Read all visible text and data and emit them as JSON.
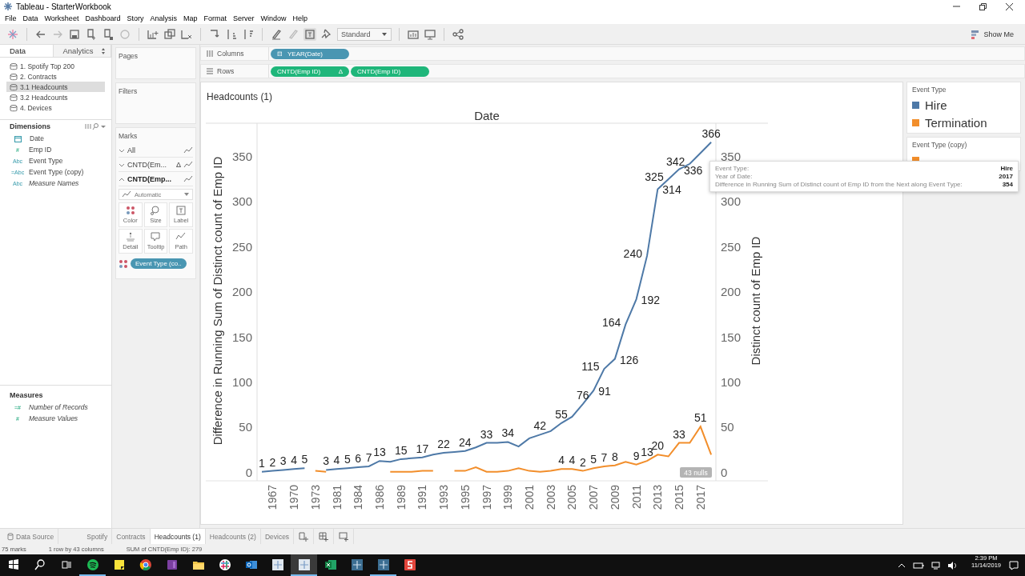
{
  "window": {
    "title": "Tableau - StarterWorkbook"
  },
  "menu": [
    "File",
    "Data",
    "Worksheet",
    "Dashboard",
    "Story",
    "Analysis",
    "Map",
    "Format",
    "Server",
    "Window",
    "Help"
  ],
  "toolbar": {
    "fit": "Standard",
    "show_me": "Show Me"
  },
  "data_pane": {
    "tabs": [
      {
        "label": "Data",
        "selected": true
      },
      {
        "label": "Analytics",
        "selected": false
      }
    ],
    "sources": [
      {
        "label": "1. Spotify Top 200",
        "selected": false
      },
      {
        "label": "2. Contracts",
        "selected": false
      },
      {
        "label": "3.1 Headcounts",
        "selected": true
      },
      {
        "label": "3.2 Headcounts",
        "selected": false
      },
      {
        "label": "4. Devices",
        "selected": false
      }
    ],
    "dimensions": {
      "title": "Dimensions",
      "fields": [
        {
          "kind": "date",
          "name": "Date",
          "generated": false
        },
        {
          "kind": "number",
          "glyph": "#",
          "name": "Emp ID",
          "generated": false
        },
        {
          "kind": "string",
          "glyph": "Abc",
          "name": "Event Type",
          "generated": false
        },
        {
          "kind": "string",
          "glyph": "=Abc",
          "name": "Event Type (copy)",
          "generated": false
        },
        {
          "kind": "string",
          "glyph": "Abc",
          "name": "Measure Names",
          "generated": true
        }
      ]
    },
    "measures": {
      "title": "Measures",
      "fields": [
        {
          "kind": "number",
          "glyph": "=#",
          "name": "Number of Records",
          "generated": true
        },
        {
          "kind": "number",
          "glyph": "#",
          "name": "Measure Values",
          "generated": true
        }
      ]
    }
  },
  "cards": {
    "pages": "Pages",
    "filters": "Filters",
    "marks": {
      "title": "Marks",
      "layers": [
        {
          "label": "All",
          "expanded": false
        },
        {
          "label": "CNTD(Em...",
          "glyph": "Δ",
          "expanded": false
        },
        {
          "label": "CNTD(Emp...",
          "expanded": true
        }
      ],
      "mark_type": "Automatic",
      "buttons": [
        "Color",
        "Size",
        "Label",
        "Detail",
        "Tooltip",
        "Path"
      ],
      "pills": [
        {
          "label": "Event Type (co..",
          "kind": "color"
        }
      ]
    }
  },
  "shelves": {
    "columns": {
      "label": "Columns",
      "pills": [
        {
          "glyph": "⊟",
          "label": "YEAR(Date)",
          "kind": "discrete"
        }
      ]
    },
    "rows": {
      "label": "Rows",
      "pills": [
        {
          "label": "CNTD(Emp ID)",
          "glyph": "Δ",
          "kind": "continuous"
        },
        {
          "label": "CNTD(Emp ID)",
          "kind": "continuous"
        }
      ]
    }
  },
  "view": {
    "title": "Headcounts (1)",
    "null_indicator": "43 nulls",
    "chart_data": {
      "type": "line",
      "title": "Date",
      "ylabel": "Difference in Running Sum of Distinct count of Emp ID",
      "y2label": "Distinct count of Emp ID",
      "categories": [
        null,
        "1967",
        null,
        "1970",
        null,
        "1973",
        null,
        "1981",
        null,
        "1984",
        null,
        "1986",
        null,
        "1989",
        null,
        "1991",
        null,
        "1993",
        null,
        "1995",
        null,
        "1997",
        null,
        "1999",
        null,
        "2001",
        null,
        "2003",
        null,
        "2005",
        null,
        "2007",
        null,
        "2009",
        null,
        "2011",
        null,
        "2013",
        null,
        "2015",
        null,
        "2017",
        null
      ],
      "ylim": [
        -9,
        387
      ],
      "yticks": [
        0,
        50,
        100,
        150,
        200,
        250,
        300,
        350
      ],
      "y2ticks": [
        0,
        50,
        100,
        150,
        200,
        250,
        300,
        350
      ],
      "y2lim": [
        -9,
        387
      ],
      "series": [
        {
          "color": "#4e79a7",
          "values": [
            1,
            2,
            3,
            4,
            5,
            null,
            3,
            4,
            5,
            6,
            7,
            13,
            12,
            15,
            16,
            17,
            20,
            22,
            23,
            24,
            28,
            33,
            33,
            34,
            29,
            38,
            42,
            46,
            55,
            62,
            76,
            91,
            115,
            126,
            164,
            192,
            240,
            314,
            325,
            336,
            342,
            354,
            366
          ],
          "value_labels": [
            "1",
            "2",
            "3",
            "4",
            "5",
            null,
            "3",
            "4",
            "5",
            "6",
            "7",
            "13",
            null,
            "15",
            null,
            "17",
            null,
            "22",
            null,
            "24",
            null,
            "33",
            null,
            "34",
            null,
            null,
            "42",
            null,
            "55",
            null,
            "76",
            "91",
            "115",
            "126",
            "164",
            "192",
            "240",
            "314",
            "325",
            "336",
            "342",
            null,
            "366"
          ]
        },
        {
          "color": "#f28e2b",
          "values": [
            null,
            null,
            null,
            null,
            null,
            2,
            1,
            null,
            null,
            null,
            null,
            null,
            1,
            1,
            1,
            2,
            2,
            null,
            2,
            2,
            6,
            1,
            1,
            2,
            5,
            2,
            1,
            2,
            4,
            4,
            2,
            5,
            7,
            8,
            12,
            9,
            13,
            20,
            18,
            33,
            33,
            51,
            20
          ],
          "value_labels": [
            null,
            null,
            null,
            null,
            null,
            null,
            null,
            null,
            null,
            null,
            null,
            null,
            null,
            null,
            null,
            null,
            null,
            null,
            null,
            null,
            null,
            null,
            null,
            null,
            null,
            null,
            null,
            null,
            "4",
            "4",
            "2",
            "5",
            "7",
            "8",
            null,
            "9",
            "13",
            "20",
            null,
            "33",
            null,
            "51",
            null
          ]
        }
      ]
    },
    "tooltip": [
      {
        "label": "Event Type:",
        "value": "Hire"
      },
      {
        "label": "Year of Date:",
        "value": "2017"
      },
      {
        "label": "Difference in Running Sum of Distinct count of Emp ID from the Next along Event Type:",
        "value": "354"
      }
    ]
  },
  "legends": [
    {
      "title": "Event Type",
      "items": [
        {
          "label": "Hire",
          "color": "#4e79a7"
        },
        {
          "label": "Termination",
          "color": "#f28e2b"
        }
      ]
    },
    {
      "title": "Event Type (copy)",
      "items": [
        {
          "color": "#f28e2b"
        }
      ]
    }
  ],
  "sheet_tabs": {
    "data_source": "Data Source",
    "tabs": [
      {
        "label": "Spotify",
        "selected": false
      },
      {
        "label": "Contracts",
        "selected": false
      },
      {
        "label": "Headcounts (1)",
        "selected": true
      },
      {
        "label": "Headcounts (2)",
        "selected": false
      },
      {
        "label": "Devices",
        "selected": false
      }
    ]
  },
  "status_bar": [
    "75 marks",
    "1 row by 43 columns",
    "SUM of CNTD(Emp ID): 279"
  ],
  "taskbar": {
    "time": "2:39 PM",
    "date": "11/14/2019",
    "apps": [
      {
        "kind": "music",
        "running": true,
        "selected": false
      },
      {
        "kind": "notes",
        "running": false,
        "selected": false
      },
      {
        "kind": "browser",
        "running": false,
        "selected": false
      },
      {
        "kind": "notebook",
        "running": false,
        "selected": false
      },
      {
        "kind": "folder",
        "running": false,
        "selected": false
      },
      {
        "kind": "chat",
        "running": false,
        "selected": false
      },
      {
        "kind": "mail",
        "running": false,
        "selected": false
      },
      {
        "kind": "tableau",
        "running": false,
        "selected": false
      },
      {
        "kind": "tableau",
        "running": true,
        "selected": true
      },
      {
        "kind": "spreadsheet",
        "running": false,
        "selected": false
      },
      {
        "kind": "tableau-dark",
        "running": false,
        "selected": false
      },
      {
        "kind": "tableau-dark",
        "running": true,
        "selected": false
      },
      {
        "kind": "slides",
        "running": false,
        "selected": false
      }
    ]
  }
}
